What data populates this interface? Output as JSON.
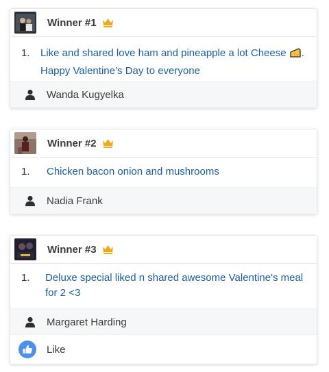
{
  "winners": [
    {
      "title": "Winner #1",
      "entry_number": "1.",
      "entry_text": "Like and shared love ham and pineapple a lot Cheese",
      "entry_text_tail": ".",
      "entry_text_line2": "Happy Valentine’s Day to everyone",
      "author": "Wanda Kugyelka"
    },
    {
      "title": "Winner #2",
      "entry_number": "1.",
      "entry_text": "Chicken bacon onion and mushrooms",
      "author": "Nadia Frank"
    },
    {
      "title": "Winner #3",
      "entry_number": "1.",
      "entry_text": "Deluxe special liked n shared awesome Valentine's meal for 2 <3",
      "author": "Margaret Harding",
      "like_label": "Like"
    }
  ],
  "colors": {
    "link_text": "#1b5e9a",
    "crown": "#f0a81c",
    "like_icon_bg": "#4c92e8",
    "meta_row_bg": "#f6f7f9"
  },
  "icons": {
    "crown": "crown-icon",
    "cheese": "cheese-icon",
    "user": "user-icon",
    "like": "thumbs-up-icon"
  }
}
